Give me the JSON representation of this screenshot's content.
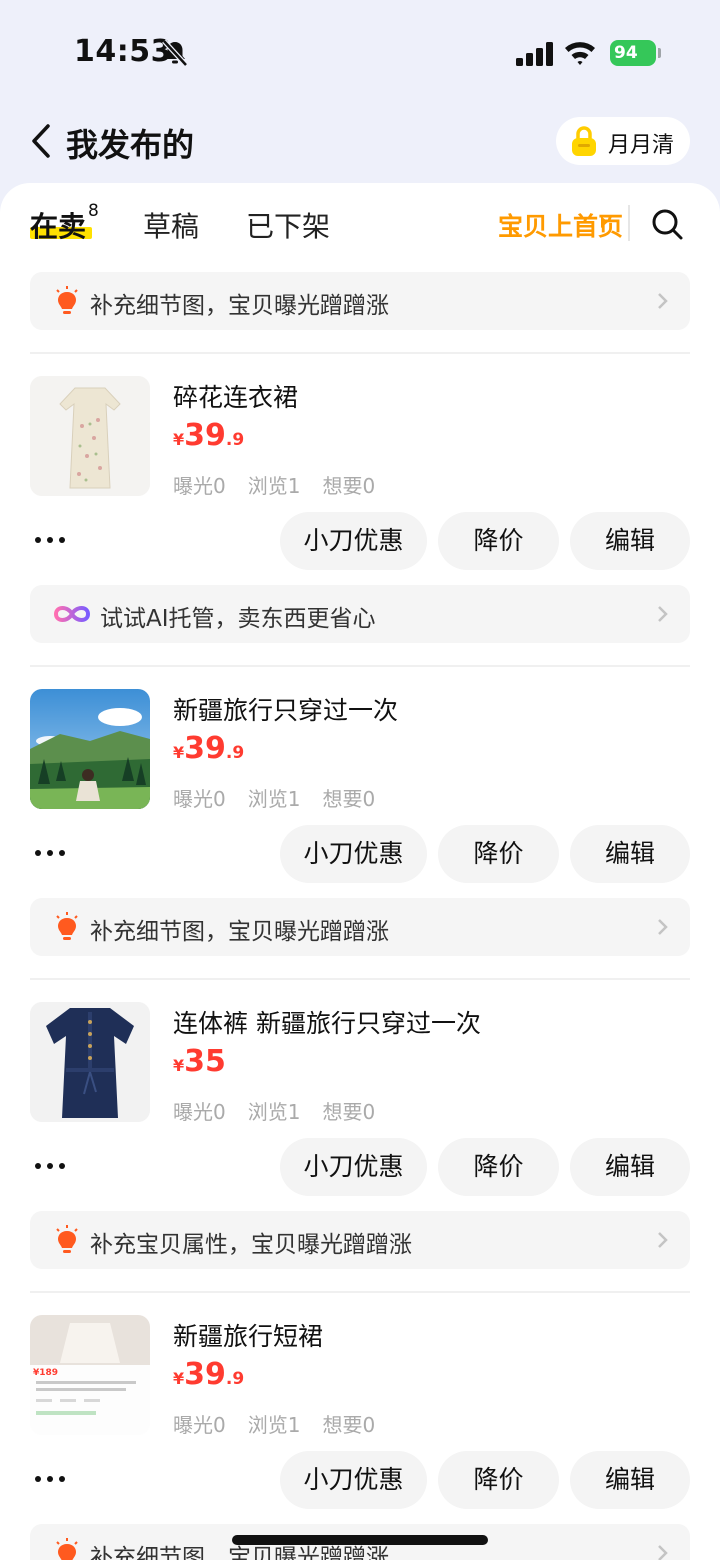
{
  "status_bar": {
    "time": "14:53",
    "battery": "94"
  },
  "header": {
    "title": "我发布的",
    "badge_label": "月月清"
  },
  "tabs": {
    "selling": "在卖",
    "selling_count": "8",
    "drafts": "草稿",
    "removed": "已下架",
    "promo": "宝贝上首页"
  },
  "tips": {
    "detail_photos": "补充细节图，宝贝曝光蹭蹭涨",
    "ai_hosting": "试试AI托管，卖东西更省心",
    "attributes": "补充宝贝属性，宝贝曝光蹭蹭涨"
  },
  "items": [
    {
      "title": "碎花连衣裙",
      "yen": "¥",
      "price_int": "39",
      "price_dec": ".9",
      "exposure": "曝光0",
      "views": "浏览1",
      "wants": "想要0"
    },
    {
      "title": "新疆旅行只穿过一次",
      "yen": "¥",
      "price_int": "39",
      "price_dec": ".9",
      "exposure": "曝光0",
      "views": "浏览1",
      "wants": "想要0"
    },
    {
      "title": "连体裤 新疆旅行只穿过一次",
      "yen": "¥",
      "price_int": "35",
      "price_dec": "",
      "exposure": "曝光0",
      "views": "浏览1",
      "wants": "想要0"
    },
    {
      "title": "新疆旅行短裙",
      "yen": "¥",
      "price_int": "39",
      "price_dec": ".9",
      "exposure": "曝光0",
      "views": "浏览1",
      "wants": "想要0"
    }
  ],
  "actions": {
    "discount": "小刀优惠",
    "reduce": "降价",
    "edit": "编辑"
  },
  "thumb4_price": "¥189",
  "colors": {
    "accent_orange": "#ff9a00",
    "price_red": "#ff3b30",
    "tab_highlight": "#ffe100"
  },
  "icons": [
    "bell-slash-icon",
    "signal-icon",
    "wifi-icon",
    "back-icon",
    "lock-icon",
    "search-icon",
    "bulb-icon",
    "ai-icon",
    "chevron-right-icon",
    "more-icon"
  ]
}
